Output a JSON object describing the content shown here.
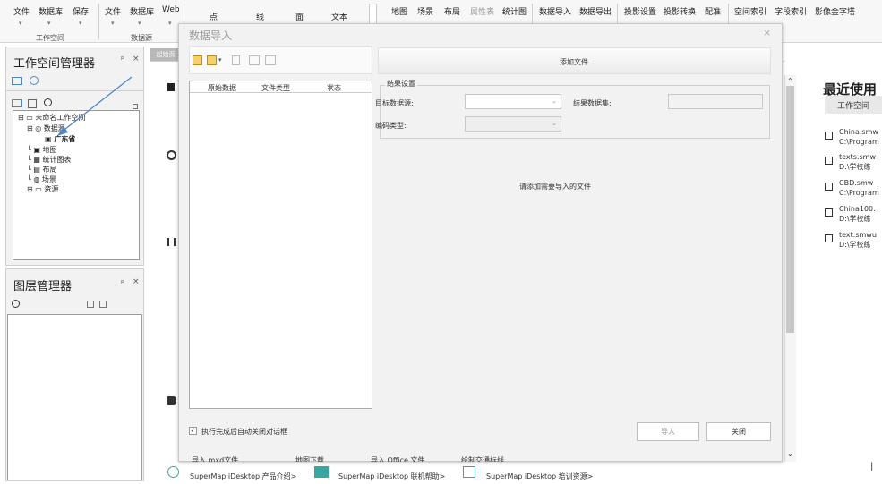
{
  "ribbon": {
    "items": [
      "文件",
      "数据库",
      "保存",
      "文件",
      "数据库",
      "Web",
      "点",
      "线",
      "面",
      "文本",
      "地图",
      "场景",
      "布局",
      "属性表",
      "统计图",
      "数据导入",
      "数据导出",
      "投影设置",
      "投影转换",
      "配准",
      "空间索引",
      "字段索引",
      "影像金字塔"
    ],
    "groups": [
      "工作空间",
      "数据源"
    ],
    "dropdown": "▾"
  },
  "workspace_manager": {
    "title": "工作空间管理器",
    "pin": "ᵖ",
    "close": "×",
    "tree": [
      "未命名工作空间",
      "数据源",
      "广东省",
      "地图",
      "统计图表",
      "布局",
      "场景",
      "资源"
    ]
  },
  "layer_manager": {
    "title": "图层管理器",
    "pin": "ᵖ",
    "close": "×"
  },
  "start_tab": {
    "label": "起始页"
  },
  "dialog": {
    "title": "数据导入",
    "close": "×",
    "add_file_label": "添加文件",
    "columns": [
      "原始数据",
      "文件类型",
      "状态"
    ],
    "result_settings": "结果设置",
    "target_datasource_label": "目标数据源:",
    "result_dataset_label": "结果数据集:",
    "encoding_label": "编码类型:",
    "hint": "请添加需要导入的文件",
    "auto_close_label": "执行完成后自动关闭对话框",
    "auto_close_checked": true,
    "import_button": "导入",
    "close_button": "关闭"
  },
  "start_page": {
    "recent_title": "最近使用",
    "workspace_tab": "工作空间",
    "recent": [
      {
        "name": "China.smw",
        "path": "C:\\Program"
      },
      {
        "name": "texts.smw",
        "path": "D:\\学校练"
      },
      {
        "name": "CBD.smw",
        "path": "C:\\Program"
      },
      {
        "name": "China100.",
        "path": "D:\\学校练"
      },
      {
        "name": "text.smwu",
        "path": "D:\\学校练"
      }
    ],
    "cut_links": [
      "导入 mxd文件",
      "地图下载",
      "导入 Office 文件",
      "绘制交通标线"
    ],
    "bottom_links": [
      "SuperMap iDesktop 产品介绍>",
      "SuperMap iDesktop 联机帮助>",
      "SuperMap iDesktop 培训资源>"
    ]
  },
  "colors": {
    "accent": "#3a7bd5",
    "arrow": "#4f86c6"
  }
}
